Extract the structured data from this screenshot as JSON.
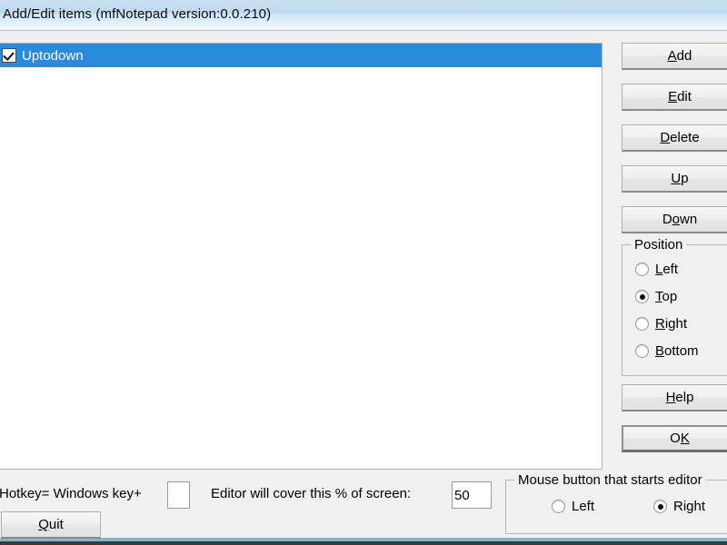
{
  "window": {
    "title": "Add/Edit items  (mfNotepad version:0.0.210)",
    "title_visible_clipped": "d/Edit items  (mfNotepad version:0.0.210)"
  },
  "list": {
    "items": [
      {
        "label": "Uptodown",
        "checked": true,
        "selected": true
      }
    ]
  },
  "buttons": {
    "add": {
      "pre": "",
      "accel": "A",
      "post": "dd"
    },
    "edit": {
      "pre": "",
      "accel": "E",
      "post": "dit"
    },
    "delete": {
      "pre": "",
      "accel": "D",
      "post": "elete"
    },
    "up": {
      "pre": "",
      "accel": "U",
      "post": "p"
    },
    "down": {
      "pre": "D",
      "accel": "o",
      "post": "wn"
    },
    "help": {
      "pre": "",
      "accel": "H",
      "post": "elp"
    },
    "ok": {
      "pre": "O",
      "accel": "K",
      "post": ""
    },
    "quit": {
      "pre": "",
      "accel": "Q",
      "post": "uit"
    }
  },
  "position_group": {
    "title": "Position",
    "options": [
      {
        "pre": "",
        "accel": "L",
        "post": "eft",
        "selected": false
      },
      {
        "pre": "",
        "accel": "T",
        "post": "op",
        "selected": true
      },
      {
        "pre": "",
        "accel": "R",
        "post": "ight",
        "selected": false
      },
      {
        "pre": "",
        "accel": "B",
        "post": "ottom",
        "selected": false
      }
    ]
  },
  "mouse_group": {
    "title": "Mouse button that starts editor",
    "options": [
      {
        "label": "Left",
        "selected": false
      },
      {
        "label": "Right",
        "selected": true
      }
    ]
  },
  "bottom": {
    "hotkey_label": "Hotkey= Windows key+",
    "hotkey_label_clipped": "otkey= Windows key+",
    "hotkey_value": "",
    "hotkey_placeholder": "",
    "percent_label": "Editor will cover this % of screen:",
    "percent_value": "50"
  },
  "colors": {
    "selection_blue": "#2a8bdd",
    "title_gradient_top": "#c8dff0",
    "window_face": "#f0f0f0",
    "border_blue": "#7cb8d4",
    "desktop": "#3a3a3c"
  }
}
